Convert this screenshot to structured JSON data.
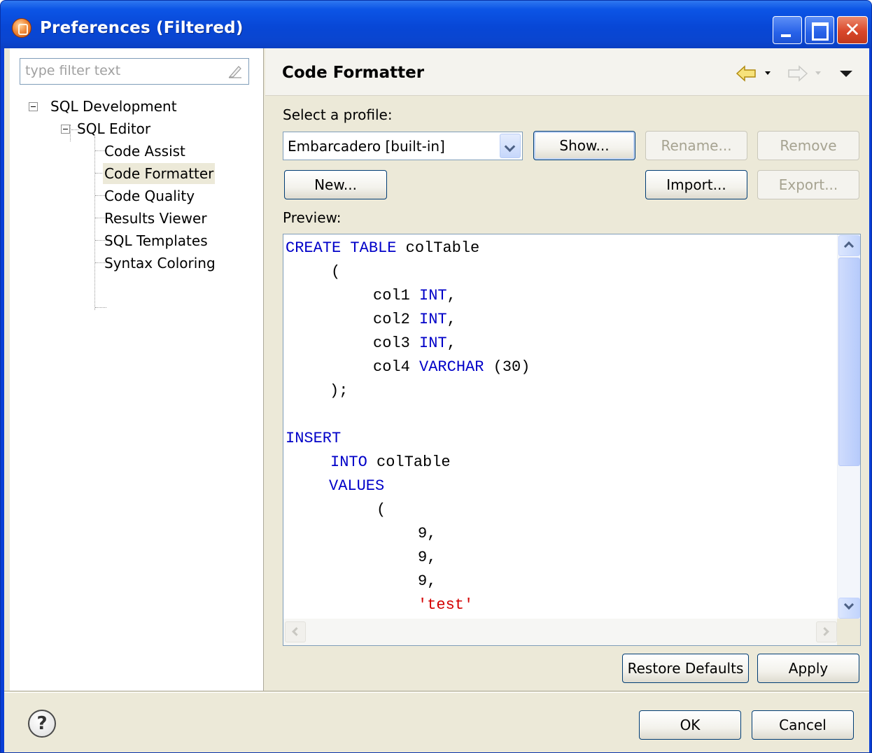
{
  "window": {
    "title": "Preferences (Filtered)"
  },
  "filter": {
    "placeholder": "type filter text"
  },
  "tree": {
    "items": [
      {
        "label": "SQL Development"
      },
      {
        "label": "SQL Editor"
      },
      {
        "label": "Code Assist"
      },
      {
        "label": "Code Formatter"
      },
      {
        "label": "Code Quality"
      },
      {
        "label": "Results Viewer"
      },
      {
        "label": "SQL Templates"
      },
      {
        "label": "Syntax Coloring"
      }
    ],
    "selected": "Code Formatter"
  },
  "page": {
    "title": "Code Formatter",
    "profile_label": "Select a profile:",
    "profile_value": "Embarcadero [built-in]",
    "buttons": {
      "show": "Show...",
      "rename": "Rename...",
      "remove": "Remove",
      "new": "New...",
      "import": "Import...",
      "export": "Export..."
    },
    "preview_label": "Preview:",
    "preview_lines": [
      {
        "parts": [
          {
            "t": "CREATE TABLE",
            "k": "kw"
          },
          {
            "t": " colTable",
            "k": ""
          }
        ]
      },
      {
        "parts": [
          {
            "t": "(",
            "k": ""
          }
        ]
      },
      {
        "parts": [
          {
            "t": "col1 ",
            "k": ""
          },
          {
            "t": "INT",
            "k": "kw"
          },
          {
            "t": ",",
            "k": ""
          }
        ]
      },
      {
        "parts": [
          {
            "t": "col2 ",
            "k": ""
          },
          {
            "t": "INT",
            "k": "kw"
          },
          {
            "t": ",",
            "k": ""
          }
        ]
      },
      {
        "parts": [
          {
            "t": "col3 ",
            "k": ""
          },
          {
            "t": "INT",
            "k": "kw"
          },
          {
            "t": ",",
            "k": ""
          }
        ]
      },
      {
        "parts": [
          {
            "t": "col4 ",
            "k": ""
          },
          {
            "t": "VARCHAR",
            "k": "kw"
          },
          {
            "t": " (30)",
            "k": ""
          }
        ]
      },
      {
        "parts": [
          {
            "t": ");",
            "k": ""
          }
        ]
      },
      {
        "parts": [
          {
            "t": "INSERT",
            "k": "kw"
          }
        ]
      },
      {
        "parts": [
          {
            "t": "INTO",
            "k": "kw"
          },
          {
            "t": " colTable",
            "k": ""
          }
        ]
      },
      {
        "parts": [
          {
            "t": "VALUES",
            "k": "kw"
          }
        ]
      },
      {
        "parts": [
          {
            "t": "(",
            "k": ""
          }
        ]
      },
      {
        "parts": [
          {
            "t": "9,",
            "k": ""
          }
        ]
      },
      {
        "parts": [
          {
            "t": "9,",
            "k": ""
          }
        ]
      },
      {
        "parts": [
          {
            "t": "9,",
            "k": ""
          }
        ]
      },
      {
        "parts": [
          {
            "t": "'test'",
            "k": "str"
          }
        ]
      }
    ],
    "restore_defaults": "Restore Defaults",
    "apply": "Apply"
  },
  "footer": {
    "ok": "OK",
    "cancel": "Cancel",
    "help_glyph": "?"
  },
  "icons": {
    "app": "app-icon",
    "back": "back-arrow-icon",
    "forward": "forward-arrow-icon",
    "menu": "view-menu-icon",
    "clear": "clear-filter-icon",
    "help": "help-icon"
  },
  "colors": {
    "keyword": "#0000c8",
    "string": "#d40000",
    "titlebar": "#0a45cf"
  }
}
